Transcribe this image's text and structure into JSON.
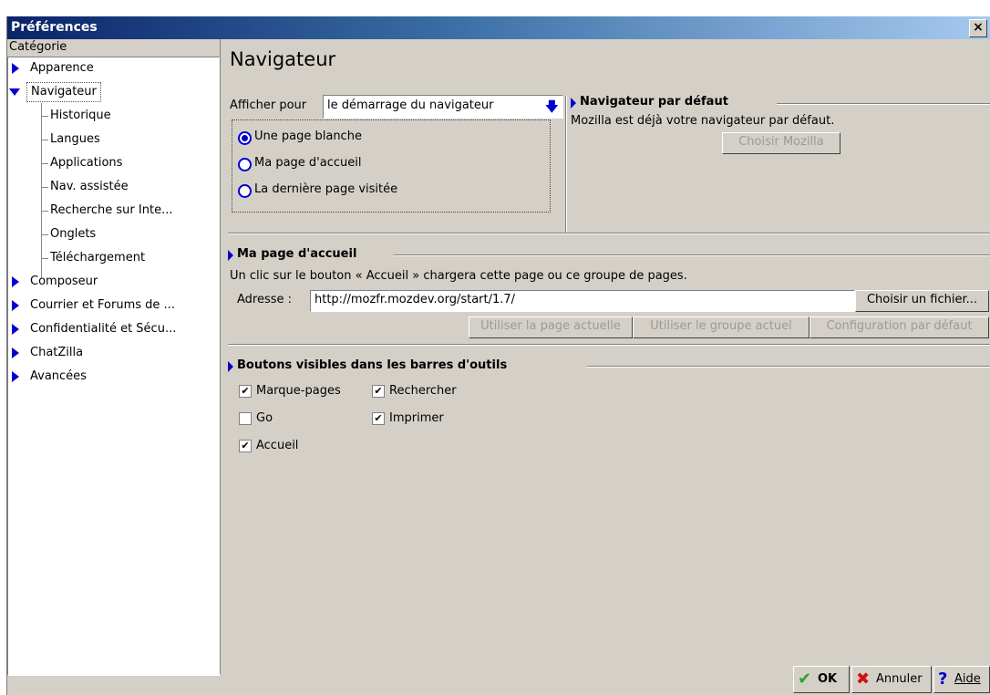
{
  "window": {
    "title": "Préférences",
    "close_glyph": "×"
  },
  "sidebar": {
    "header": "Catégorie",
    "items": [
      {
        "label": "Apparence",
        "type": "collapsed"
      },
      {
        "label": "Navigateur",
        "type": "expanded"
      },
      {
        "label": "Historique",
        "type": "child"
      },
      {
        "label": "Langues",
        "type": "child"
      },
      {
        "label": "Applications",
        "type": "child"
      },
      {
        "label": "Nav. assistée",
        "type": "child"
      },
      {
        "label": "Recherche sur Inte...",
        "type": "child"
      },
      {
        "label": "Onglets",
        "type": "child"
      },
      {
        "label": "Téléchargement",
        "type": "child"
      },
      {
        "label": "Composeur",
        "type": "collapsed"
      },
      {
        "label": "Courrier et Forums de ...",
        "type": "collapsed"
      },
      {
        "label": "Confidentialité et Sécu...",
        "type": "collapsed"
      },
      {
        "label": "ChatZilla",
        "type": "collapsed"
      },
      {
        "label": "Avancées",
        "type": "collapsed"
      }
    ]
  },
  "main": {
    "title": "Navigateur",
    "startup": {
      "label": "Afficher pour",
      "dropdown_value": "le démarrage du navigateur",
      "options": [
        {
          "label": "Une page blanche",
          "checked": true
        },
        {
          "label": "Ma page d'accueil",
          "checked": false
        },
        {
          "label": "La dernière page visitée",
          "checked": false
        }
      ]
    },
    "default_browser": {
      "title": "Navigateur par défaut",
      "text": "Mozilla est déjà votre navigateur par défaut.",
      "button": "Choisir Mozilla"
    },
    "homepage": {
      "title": "Ma page d'accueil",
      "description": "Un clic sur le bouton « Accueil » chargera cette page ou ce groupe de pages.",
      "address_label": "Adresse :",
      "address_value": "http://mozfr.mozdev.org/start/1.7/",
      "choose_file": "Choisir un fichier...",
      "use_current_page": "Utiliser la page actuelle",
      "use_current_group": "Utiliser le groupe actuel",
      "default_config": "Configuration par défaut"
    },
    "toolbar_buttons": {
      "title": "Boutons visibles dans les barres d'outils",
      "items": [
        {
          "label": "Marque-pages",
          "checked": true
        },
        {
          "label": "Rechercher",
          "checked": true
        },
        {
          "label": "Go",
          "checked": false
        },
        {
          "label": "Imprimer",
          "checked": true
        },
        {
          "label": "Accueil",
          "checked": true
        }
      ]
    }
  },
  "footer": {
    "ok": "OK",
    "cancel": "Annuler",
    "help": "Aide"
  },
  "colors": {
    "accent": "#0000cc",
    "ok_green": "#2ea02e",
    "cancel_red": "#d01010",
    "title_bar": "#0a246a"
  },
  "icons": [
    "close-icon",
    "expand-triangle-icon",
    "collapse-triangle-icon",
    "dropdown-arrow-icon",
    "check-icon",
    "cross-icon",
    "question-icon"
  ]
}
